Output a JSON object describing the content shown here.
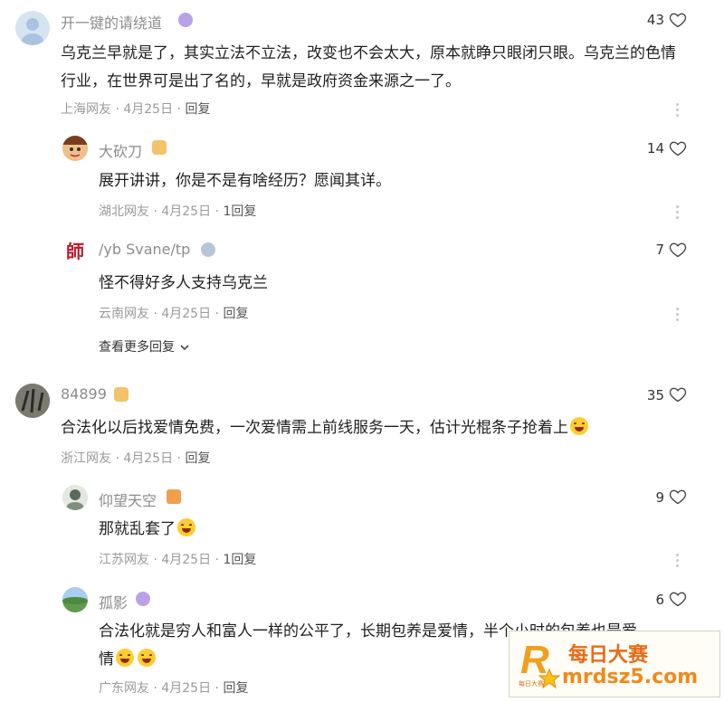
{
  "comments": [
    {
      "username": "开一键的请绕道",
      "text": "乌克兰早就是了，其实立法不立法，改变也不会太大，原本就睁只眼闭只眼。乌克兰的色情行业，在世界可是出了名的，早就是政府资金来源之一了。",
      "region": "上海网友",
      "date": "4月25日",
      "reply_label": "回复",
      "likes": "43"
    },
    {
      "username": "大砍刀",
      "text": "展开讲讲，你是不是有啥经历？愿闻其详。",
      "region": "湖北网友",
      "date": "4月25日",
      "reply_label": "1回复",
      "likes": "14"
    },
    {
      "username": "/yb Svane/tp",
      "text": "怪不得好多人支持乌克兰",
      "region": "云南网友",
      "date": "4月25日",
      "reply_label": "回复",
      "likes": "7"
    },
    {
      "username": "84899",
      "text": "合法化以后找爱情免费，一次爱情需上前线服务一天，估计光棍条子抢着上",
      "region": "浙江网友",
      "date": "4月25日",
      "reply_label": "回复",
      "likes": "35"
    },
    {
      "username": "仰望天空",
      "text": "那就乱套了",
      "region": "江苏网友",
      "date": "4月25日",
      "reply_label": "1回复",
      "likes": "9"
    },
    {
      "username": "孤影",
      "text_line1": "合法化就是穷人和富人一样的公平了，长期包养是爱情，半个小时的包养也是爱",
      "text_line2": "情",
      "region": "广东网友",
      "date": "4月25日",
      "reply_label": "回复",
      "likes": "6"
    }
  ],
  "separator": "·",
  "expand_more": "查看更多回复",
  "avatar_char_3": "師",
  "watermark": {
    "line1": "每日大赛",
    "line2": "mrdsz5.com",
    "logo_letter": "R",
    "logo_sub": "每日大赛"
  },
  "colors": {
    "heart": "#444444",
    "meta": "#9a9a9a",
    "watermark_accent": "#e96a15"
  }
}
